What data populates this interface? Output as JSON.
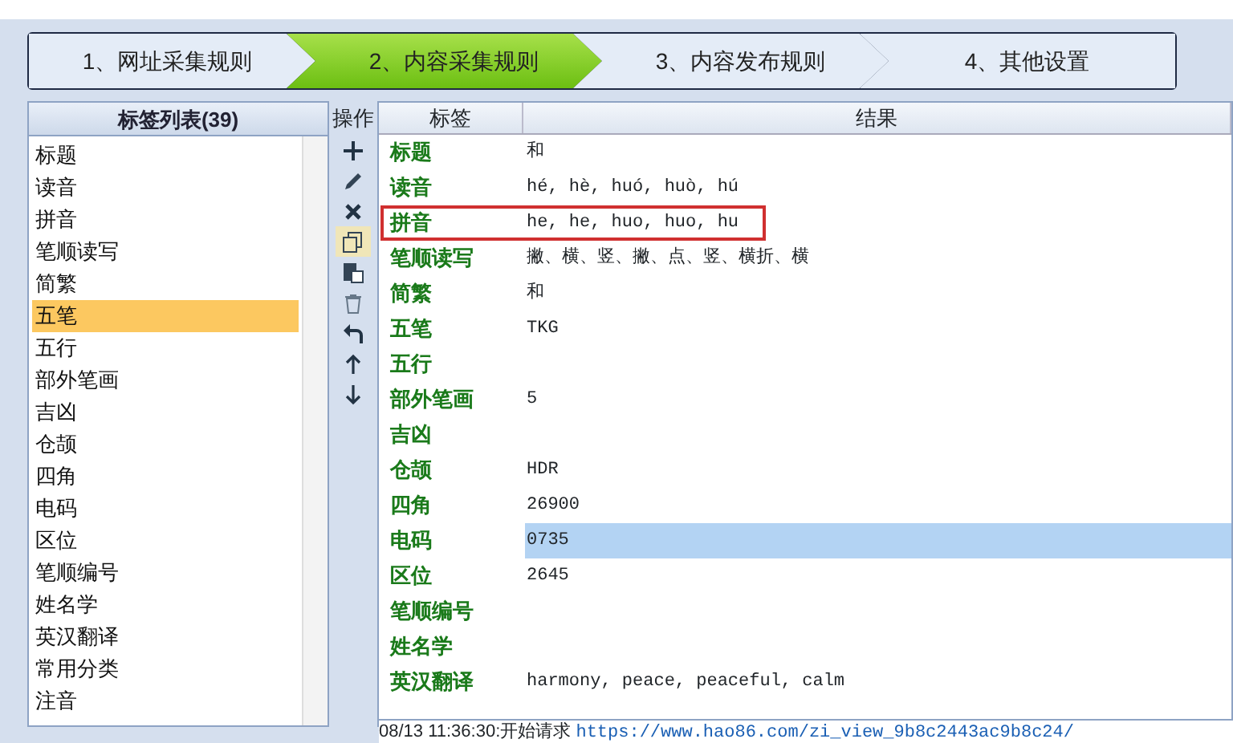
{
  "steps": [
    {
      "label": "1、网址采集规则",
      "selected": false
    },
    {
      "label": "2、内容采集规则",
      "selected": true
    },
    {
      "label": "3、内容发布规则",
      "selected": false
    },
    {
      "label": "4、其他设置",
      "selected": false
    }
  ],
  "tag_list": {
    "title": "标签列表(39)",
    "items": [
      {
        "label": "标题",
        "selected": false
      },
      {
        "label": "读音",
        "selected": false
      },
      {
        "label": "拼音",
        "selected": false
      },
      {
        "label": "笔顺读写",
        "selected": false
      },
      {
        "label": "简繁",
        "selected": false
      },
      {
        "label": "五笔",
        "selected": true
      },
      {
        "label": "五行",
        "selected": false
      },
      {
        "label": "部外笔画",
        "selected": false
      },
      {
        "label": "吉凶",
        "selected": false
      },
      {
        "label": "仓颉",
        "selected": false
      },
      {
        "label": "四角",
        "selected": false
      },
      {
        "label": "电码",
        "selected": false
      },
      {
        "label": "区位",
        "selected": false
      },
      {
        "label": "笔顺编号",
        "selected": false
      },
      {
        "label": "姓名学",
        "selected": false
      },
      {
        "label": "英汉翻译",
        "selected": false
      },
      {
        "label": "常用分类",
        "selected": false
      },
      {
        "label": "注音",
        "selected": false
      }
    ]
  },
  "toolbar": {
    "title": "操作"
  },
  "table": {
    "columns": [
      "标签",
      "结果"
    ],
    "rows": [
      {
        "tag": "标题",
        "result": "和",
        "selected": false,
        "highlighted": false
      },
      {
        "tag": "读音",
        "result": "hé, hè, huó, huò, hú",
        "selected": false,
        "highlighted": false
      },
      {
        "tag": "拼音",
        "result": "he, he, huo, huo, hu",
        "selected": false,
        "highlighted": true
      },
      {
        "tag": "笔顺读写",
        "result": "撇、横、竖、撇、点、竖、横折、横",
        "selected": false,
        "highlighted": false
      },
      {
        "tag": "简繁",
        "result": "和",
        "selected": false,
        "highlighted": false
      },
      {
        "tag": "五笔",
        "result": "TKG",
        "selected": false,
        "highlighted": false
      },
      {
        "tag": "五行",
        "result": "",
        "selected": false,
        "highlighted": false
      },
      {
        "tag": "部外笔画",
        "result": "5",
        "selected": false,
        "highlighted": false
      },
      {
        "tag": "吉凶",
        "result": "",
        "selected": false,
        "highlighted": false
      },
      {
        "tag": "仓颉",
        "result": "HDR",
        "selected": false,
        "highlighted": false
      },
      {
        "tag": "四角",
        "result": "26900",
        "selected": false,
        "highlighted": false
      },
      {
        "tag": "电码",
        "result": "0735",
        "selected": true,
        "highlighted": false
      },
      {
        "tag": "区位",
        "result": "2645",
        "selected": false,
        "highlighted": false
      },
      {
        "tag": "笔顺编号",
        "result": "",
        "selected": false,
        "highlighted": false
      },
      {
        "tag": "姓名学",
        "result": "",
        "selected": false,
        "highlighted": false
      },
      {
        "tag": "英汉翻译",
        "result": "harmony, peace, peaceful, calm",
        "selected": false,
        "highlighted": false
      }
    ]
  },
  "log": {
    "time": "08/13 11:36:30:开始请求",
    "url": "https://www.hao86.com/zi_view_9b8c2443ac9b8c24/"
  }
}
